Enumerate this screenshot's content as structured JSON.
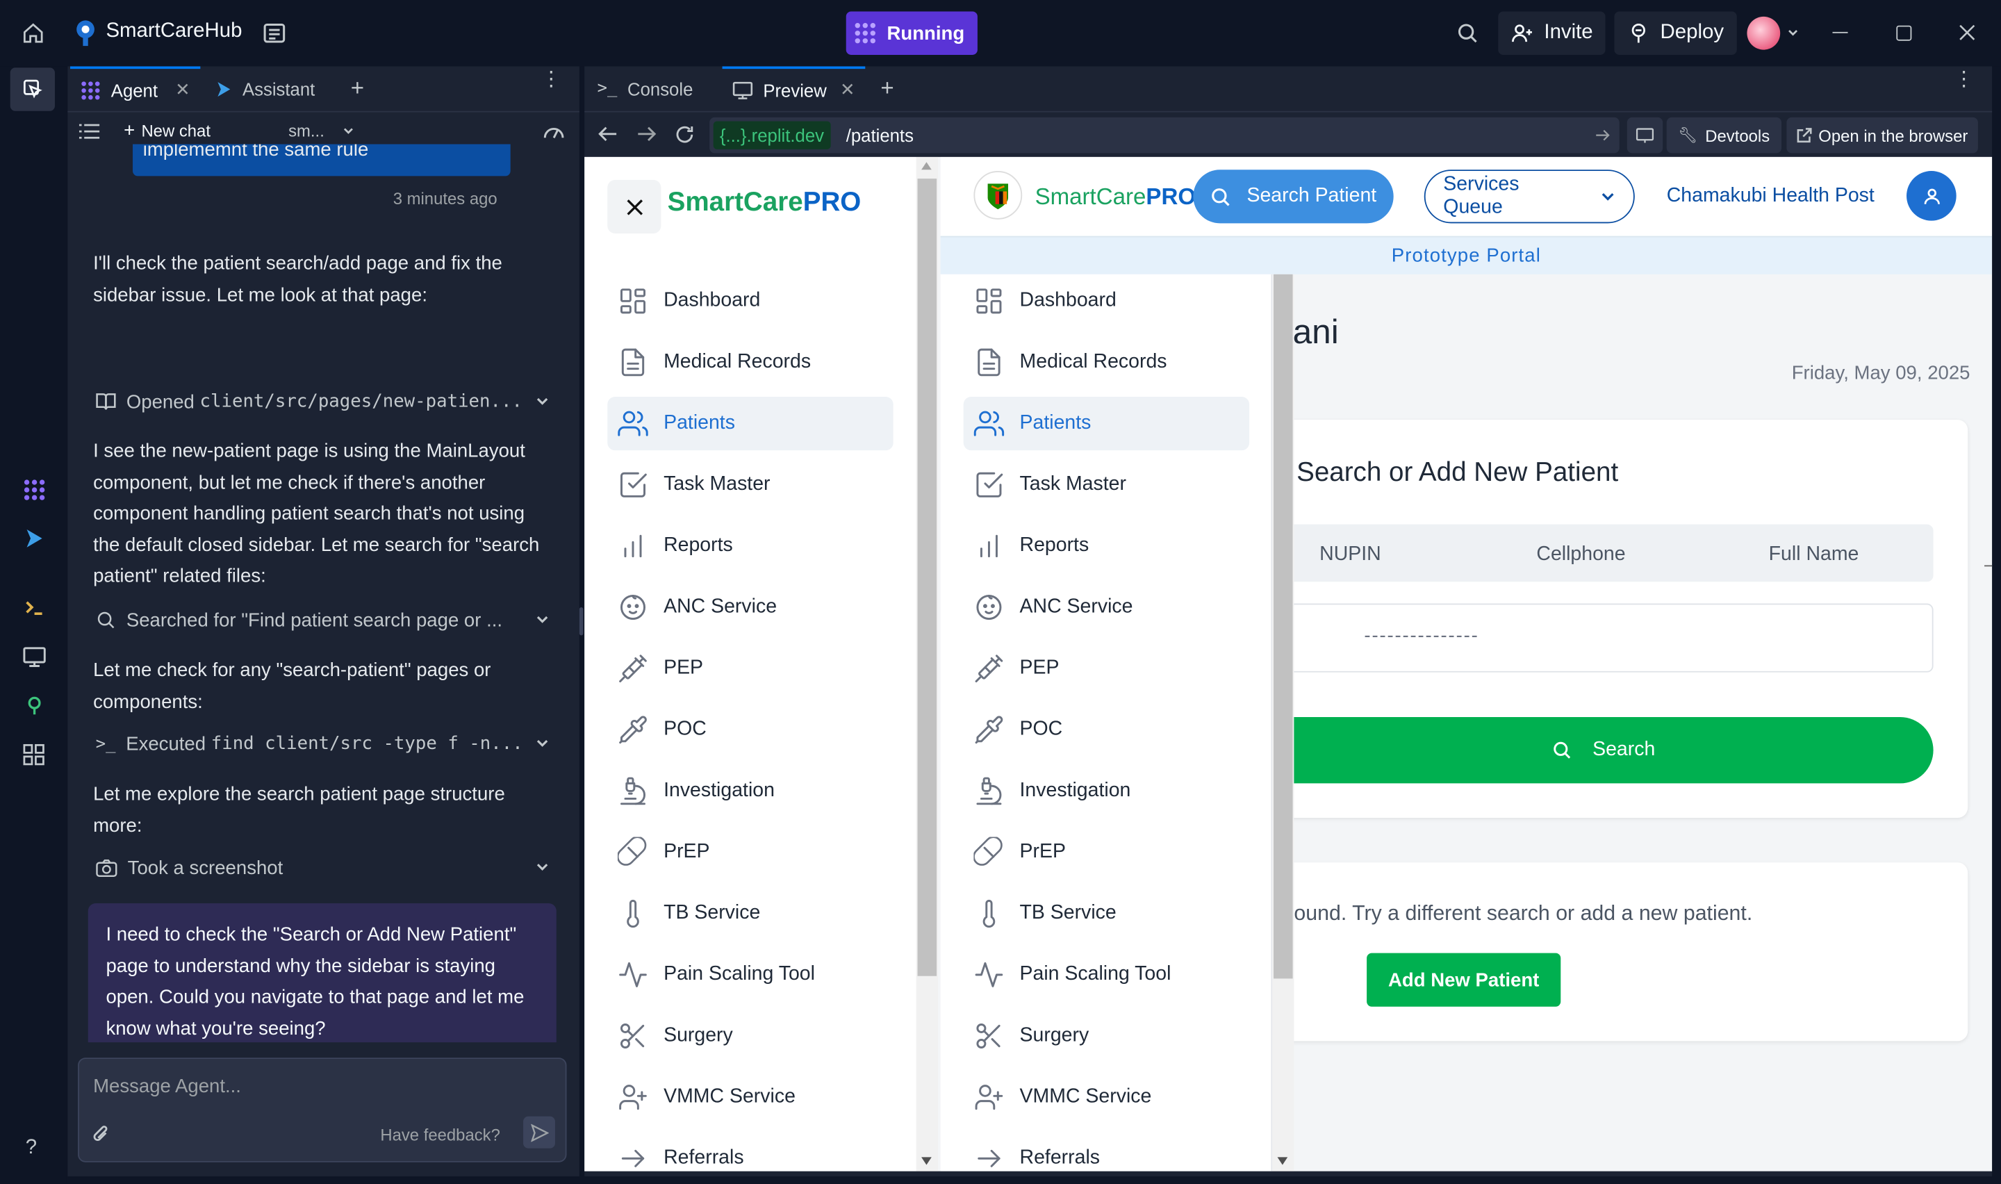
{
  "topbar": {
    "app_name": "SmartCareHub",
    "run_label": "Running",
    "invite_label": "Invite",
    "deploy_label": "Deploy"
  },
  "agent": {
    "tabs": [
      {
        "label": "Agent"
      },
      {
        "label": "Assistant"
      }
    ],
    "new_chat": "New chat",
    "chat_name": "sm...",
    "prev_msg_tail": "implememnt the same rule",
    "timestamp": "3 minutes ago",
    "messages": [
      "I'll check the patient search/add page and fix the sidebar issue. Let me look at that page:",
      "I see the new-patient page is using the MainLayout component, but let me check if there's another component handling patient search that's not using the default closed sidebar. Let me search for \"search patient\" related files:",
      "Let me check for any \"search-patient\" pages or components:",
      "Let me explore the search patient page structure more:"
    ],
    "actions": [
      {
        "prefix": "Opened ",
        "code": "client/src/pages/new-patien..."
      },
      {
        "prefix": "Searched for \"Find patient search page or ...",
        "code": ""
      },
      {
        "prefix": "Executed ",
        "code": "find client/src -type f -n..."
      },
      {
        "prefix": "Took a screenshot",
        "code": ""
      }
    ],
    "user_msg": "I need to check the \"Search or Add New Patient\" page to understand why the sidebar is staying open. Could you navigate to that page and let me know what you're seeing?",
    "input_placeholder": "Message Agent...",
    "feedback": "Have feedback?"
  },
  "preview": {
    "tabs": [
      {
        "label": "Console"
      },
      {
        "label": "Preview"
      }
    ],
    "domain": "{...}.replit.dev",
    "path": "/patients",
    "devtools": "Devtools",
    "open_browser": "Open in the browser"
  },
  "app": {
    "brand_a": "SmartCare",
    "brand_b": "PRO",
    "search_patient": "Search Patient",
    "services_queue": "Services Queue",
    "facility": "Chamakubi Health Post",
    "banner": "Prototype Portal",
    "heading_partial": "ani",
    "date": "Friday, May 09, 2025",
    "card_title": "Search or Add New Patient",
    "search_tabs": [
      "NUPIN",
      "Cellphone",
      "Full Name"
    ],
    "nupin_mask": "---------------",
    "search_button": "Search",
    "not_found": "ound. Try a different search or add a new patient.",
    "add_new": "Add New Patient",
    "nav": [
      "Dashboard",
      "Medical Records",
      "Patients",
      "Task Master",
      "Reports",
      "ANC Service",
      "PEP",
      "POC",
      "Investigation",
      "PrEP",
      "TB Service",
      "Pain Scaling Tool",
      "Surgery",
      "VMMC Service",
      "Referrals"
    ],
    "nav_icons": [
      "grid-icon",
      "document-icon",
      "users-icon",
      "checkbox-icon",
      "bar-chart-icon",
      "baby-face-icon",
      "syringe-icon",
      "pipette-icon",
      "microscope-icon",
      "pill-icon",
      "thermometer-icon",
      "pulse-icon",
      "scissors-icon",
      "user-plus-icon",
      "arrow-right-icon"
    ],
    "active_nav": "Patients"
  },
  "colors": {
    "accent": "#1e6fd1",
    "green": "#00b050",
    "run": "#5a34d6",
    "brand_green": "#1aa260",
    "brand_blue": "#0b63c6"
  }
}
